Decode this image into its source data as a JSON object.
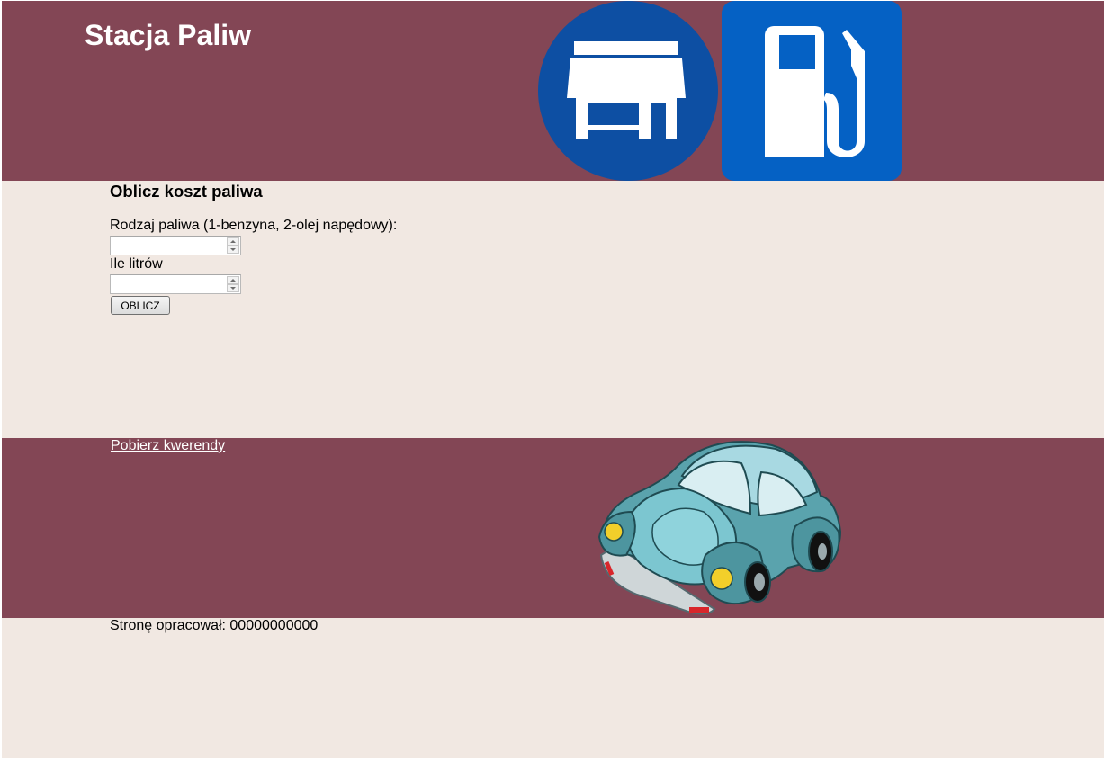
{
  "header": {
    "title": "Stacja Paliw",
    "shop_icon": "shop-icon",
    "fuel_icon": "fuel-pump-icon"
  },
  "calculator": {
    "title": "Oblicz koszt paliwa",
    "fuel_type_label": "Rodzaj paliwa (1-benzyna, 2-olej napędowy):",
    "fuel_type_value": "",
    "liters_label": "Ile litrów",
    "liters_value": "",
    "button_label": "OBLICZ"
  },
  "links": {
    "queries_label": "Pobierz kwerendy"
  },
  "footer": {
    "author_text": "Stronę opracował: 00000000000",
    "car_image": "car-illustration"
  },
  "colors": {
    "band": "#834655",
    "content_background": "#f1e8e2",
    "shop_icon_blue": "#0d4fa3",
    "fuel_icon_blue": "#0561c4"
  }
}
